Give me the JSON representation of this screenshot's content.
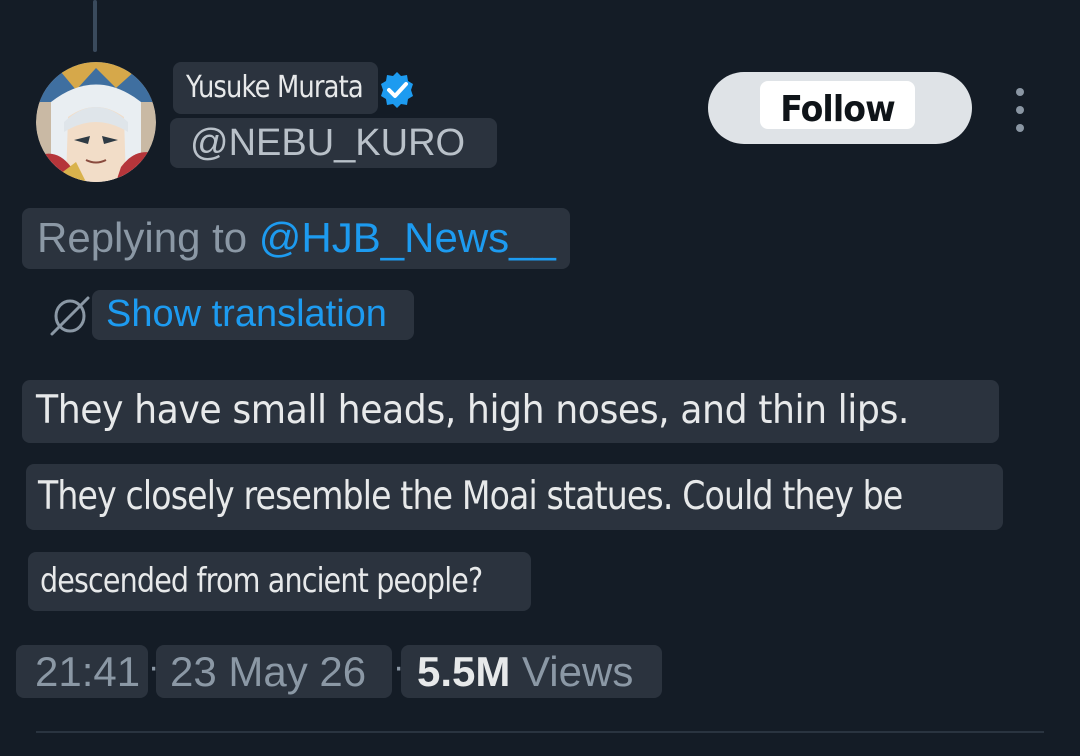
{
  "tweet": {
    "author_name": "Yusuke Murata",
    "author_handle": "@NEBU_KURO",
    "verified": true,
    "follow_label": "Follow",
    "reply_prefix": "Replying to",
    "reply_mention": "@HJB_News__",
    "show_translation_label": "Show translation",
    "body_lines": [
      "They have small heads, high noses, and thin lips.",
      "They closely resemble the Moai statues. Could they be",
      "descended from ancient people?"
    ],
    "time": "21:41",
    "date": "23 May 26",
    "separator": "·",
    "views_count": "5.5M",
    "views_label": "Views"
  },
  "icons": {
    "verified": "verified-badge-icon",
    "more": "more-options-icon",
    "translate": "translate-icon"
  },
  "colors": {
    "background": "#141c26",
    "link": "#1d9bf0",
    "muted_text": "#8b98a5",
    "primary_text": "#e7e9ea",
    "highlight_box": "#2b333e",
    "follow_button_bg": "#dfe3e7"
  }
}
